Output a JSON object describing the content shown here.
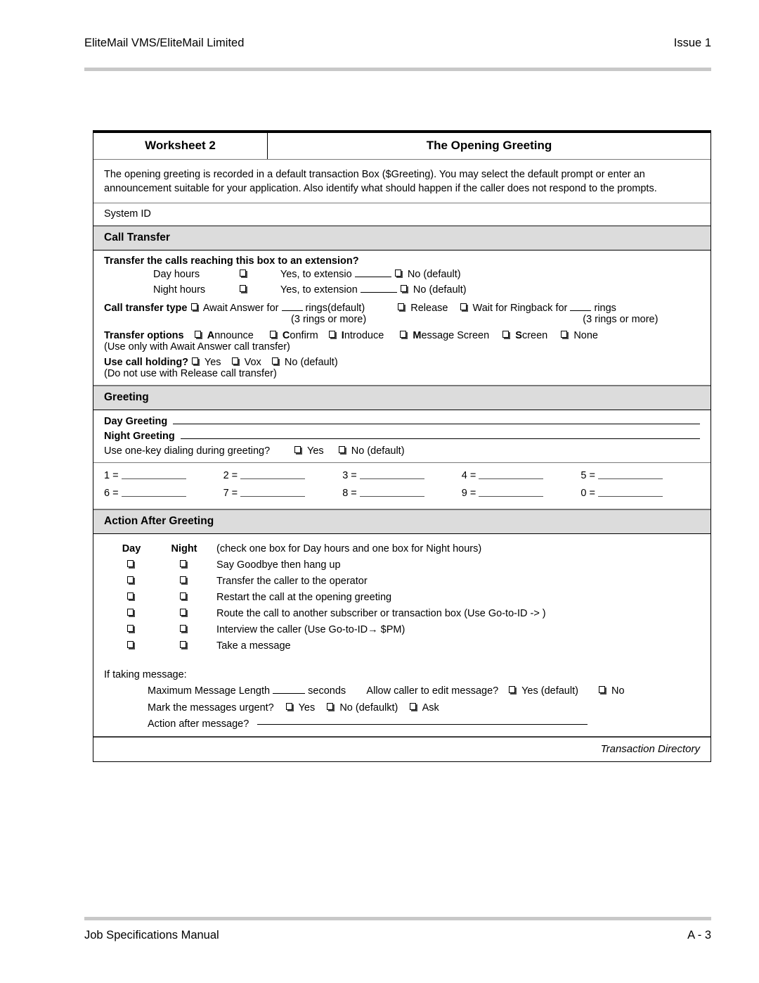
{
  "page": {
    "header_left": "EliteMail VMS/EliteMail Limited",
    "header_right": "Issue  1",
    "footer_left": "Job Specifications Manual",
    "footer_right": "A - 3"
  },
  "worksheet": {
    "title_left": "Worksheet  2",
    "title_right": "The Opening Greeting",
    "intro": "The opening greeting is recorded in a default transaction Box ($Greeting).  You may select the default prompt or enter an announcement suitable for your application. Also identify what should happen if the caller does not respond to the prompts.",
    "system_id_label": "System ID",
    "footer_note": "Transaction Directory"
  },
  "call_transfer": {
    "section_title": "Call Transfer",
    "question": "Transfer the calls reaching this box to an extension?",
    "rows": [
      {
        "label": "Day hours",
        "yes_text": "Yes, to extensio",
        "no_text": "No (default)"
      },
      {
        "label": "Night hours",
        "yes_text": "Yes, to extension",
        "no_text": "No (default)"
      }
    ],
    "transfer_type": {
      "label": "Call transfer type",
      "opt1_a": "Await Answer  for",
      "opt1_b": "rings(default)",
      "opt1_note": "(3 rings or more)",
      "opt2": "Release",
      "opt3_a": "Wait for Ringback  for",
      "opt3_b": "rings",
      "opt3_note": "(3 rings or more)"
    },
    "transfer_options": {
      "label": "Transfer options",
      "items": [
        {
          "bold": "A",
          "rest": "nnounce"
        },
        {
          "bold": "C",
          "rest": "onfirm"
        },
        {
          "bold": "I",
          "rest": "ntroduce"
        },
        {
          "bold": "M",
          "rest": "essage Screen"
        },
        {
          "bold": "S",
          "rest": "creen"
        },
        {
          "bold": "",
          "rest": "None"
        }
      ],
      "note": "(Use only with Await Answer call transfer)"
    },
    "call_holding": {
      "label": "Use call holding?",
      "opt1": "Yes",
      "opt2": "Vox",
      "opt3": "No (default)",
      "note": "(Do not use with Release call transfer)"
    }
  },
  "greeting": {
    "section_title": "Greeting",
    "day_label": "Day Greeting",
    "night_label": "Night Greeting",
    "onekey_question": "Use one-key dialing during greeting?",
    "onekey_yes": "Yes",
    "onekey_no": "No (default)",
    "keys": [
      [
        "1 =",
        "2 =",
        "3 =",
        "4 =",
        "5 ="
      ],
      [
        "6 =",
        "7 =",
        "8 =",
        "9 =",
        "0 ="
      ]
    ]
  },
  "action_after_greeting": {
    "section_title": "Action After Greeting",
    "col_day": "Day",
    "col_night": "Night",
    "col_hint": "(check one box for Day hours and one box for Night hours)",
    "options": [
      "Say Goodbye then hang up",
      "Transfer the caller to the operator",
      "Restart the call at the opening greeting",
      "Route the call to another subscriber or transaction box  (Use Go-to-ID -> )",
      "Interview the caller  (Use Go-to-ID→ $PM)",
      "Take a message"
    ],
    "if_taking": "If taking message:",
    "max_len_a": "Maximum Message Length",
    "max_len_b": "seconds",
    "edit_q": "Allow caller to edit message?",
    "edit_yes": "Yes (default)",
    "edit_no": "No",
    "urgent_q": "Mark the messages urgent?",
    "urgent_yes": "Yes",
    "urgent_no": "No (defaulkt)",
    "urgent_ask": "Ask",
    "action_after_msg": "Action after message?"
  }
}
